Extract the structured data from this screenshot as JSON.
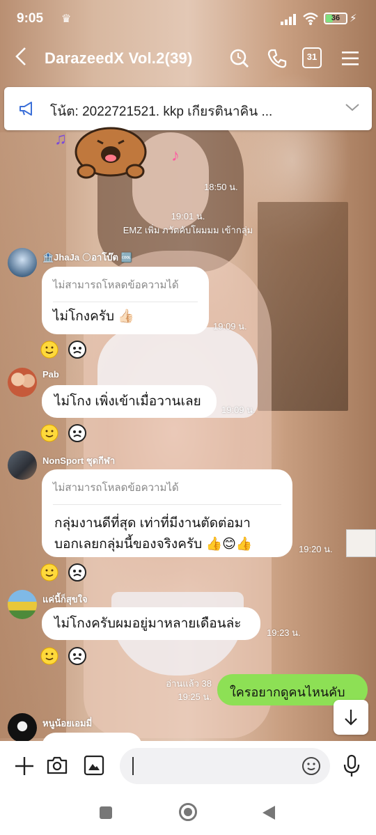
{
  "status": {
    "time": "9:05",
    "battery": "36",
    "battery_fraction": 0.36
  },
  "header": {
    "title": "DarazeedX  Vol.2(39)",
    "calendar_day": "31"
  },
  "announcement": {
    "text": "โน้ต: 2022721521. kkp เกียรตินาคิน ..."
  },
  "messages": {
    "m0_time": "18:50 น.",
    "system_time": "19:01 น.",
    "system_text": "EMZ เพิ่ม ภวัตคับโผมมม เข้ากลุ่ม",
    "m1": {
      "sender": "🏦JhaJa 🌕อาโบ๊ต 🆒",
      "quote": "ไม่สามารถโหลดข้อความได้",
      "text": "ไม่โกงครับ 👍🏻",
      "time": "19:09 น."
    },
    "m2": {
      "sender": "Pab",
      "text": "ไม่โกง เพิ่งเข้าเมื่อวานเลย",
      "time": "19:09 น."
    },
    "m3": {
      "sender": "NonSport ชุดกีฬา",
      "quote": "ไม่สามารถโหลดข้อความได้",
      "line1": "กลุ่มงานดีที่สุด เท่าที่มีงานตัดต่อมา",
      "line2": "บอกเลยกลุ่มนี้ของจริงครับ 👍😊👍",
      "time": "19:20 น."
    },
    "m4": {
      "sender": "แค่นี้ก็สุขใจ",
      "text": "ไม่โกงครับผมอยู่มาหลายเดือนล่ะ",
      "time": "19:23 น."
    },
    "mine": {
      "read": "อ่านแล้ว 38",
      "time": "19:25 น.",
      "text": "ใครอยากดูคนไหนคับ"
    },
    "m5": {
      "sender": "หนูน้อยเอมมี่"
    }
  },
  "icons": {
    "back": "chevron-left-icon",
    "search": "search-icon",
    "call": "phone-icon",
    "calendar": "calendar-icon",
    "menu": "menu-icon",
    "announce": "megaphone-icon",
    "expand": "chevron-down-icon",
    "add": "plus-icon",
    "camera": "camera-icon",
    "image": "image-icon",
    "emoji": "emoji-icon",
    "mic": "mic-icon",
    "scroll": "arrow-down-icon",
    "nav_recent": "square-icon",
    "nav_home": "circle-icon",
    "nav_back": "triangle-back-icon"
  },
  "colors": {
    "my_bubble": "#8de055",
    "text_dark": "#111111",
    "accent_blue": "#3b6fd8"
  }
}
